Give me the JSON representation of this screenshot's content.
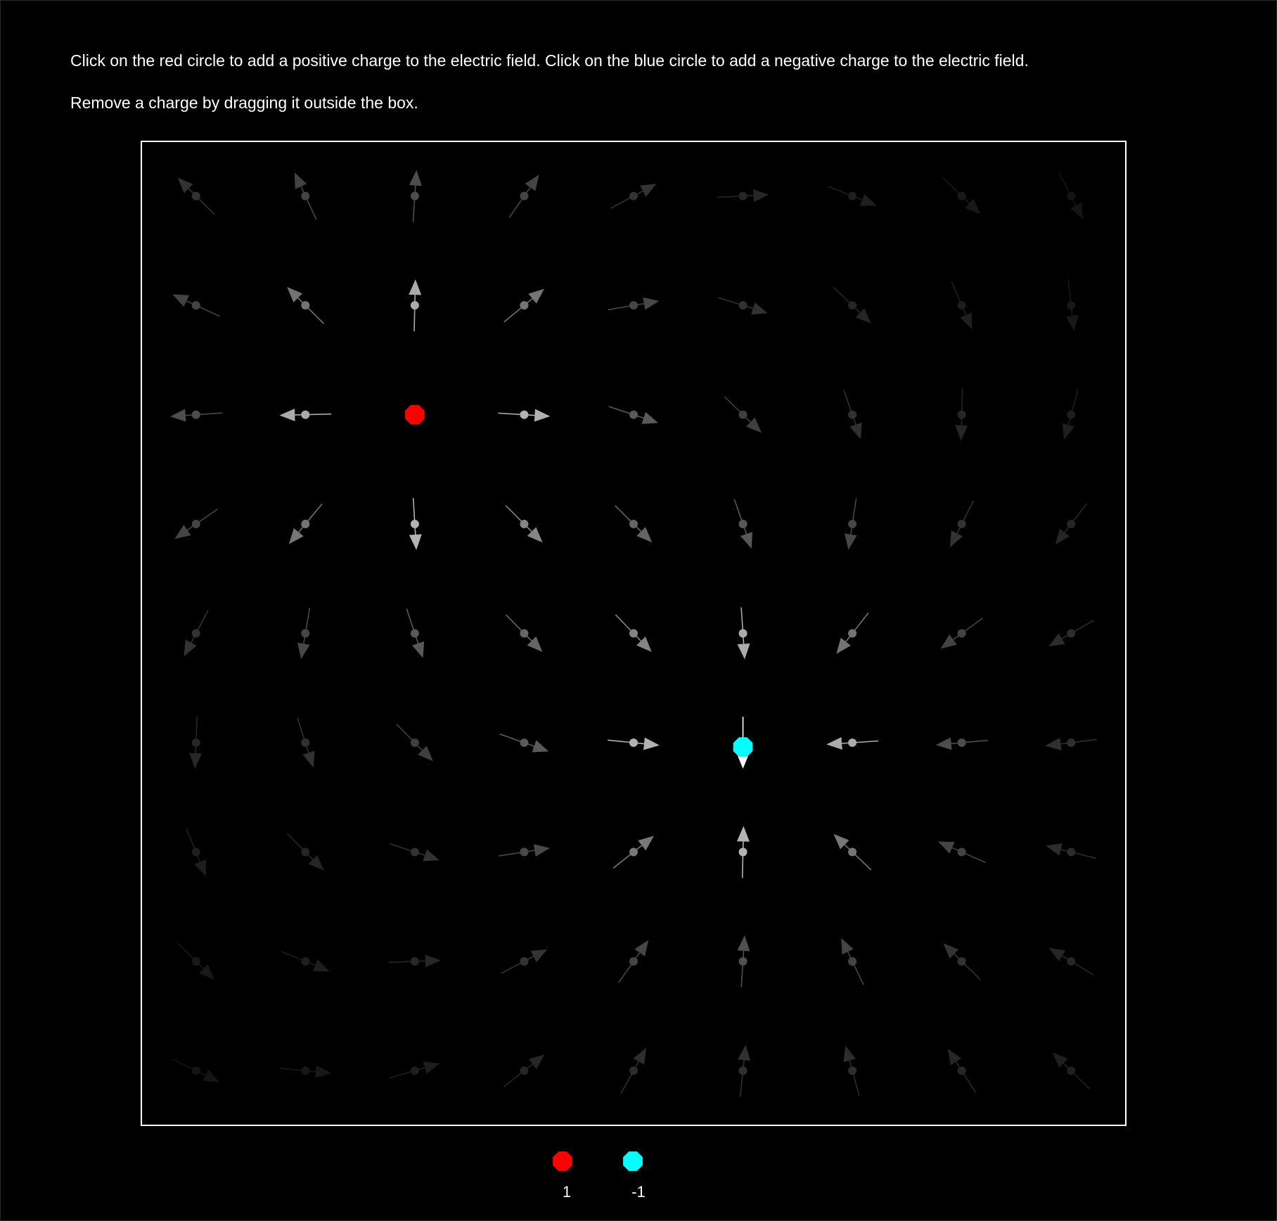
{
  "instructions": {
    "line1": "Click on the red circle to add a positive charge to the electric field. Click on the blue circle to add a negative charge to the electric field.",
    "line2": "Remove a charge by dragging it outside the box."
  },
  "colors": {
    "background": "#000000",
    "positive": "#ff0000",
    "negative": "#00ffff",
    "box_border": "#ffffff",
    "arrow": "#ffffff"
  },
  "field": {
    "grid_columns": 9,
    "grid_rows": 9,
    "charges": [
      {
        "name": "positive-charge",
        "sign": 1,
        "color": "#ff0000",
        "grid_x": 2.5,
        "grid_y": 2.5
      },
      {
        "name": "negative-charge",
        "sign": -1,
        "color": "#00ffff",
        "grid_x": 5.5,
        "grid_y": 5.54
      }
    ]
  },
  "palette": {
    "positive": {
      "label": "1",
      "color": "#ff0000",
      "value": 1
    },
    "negative": {
      "label": "-1",
      "color": "#00ffff",
      "value": -1
    }
  }
}
